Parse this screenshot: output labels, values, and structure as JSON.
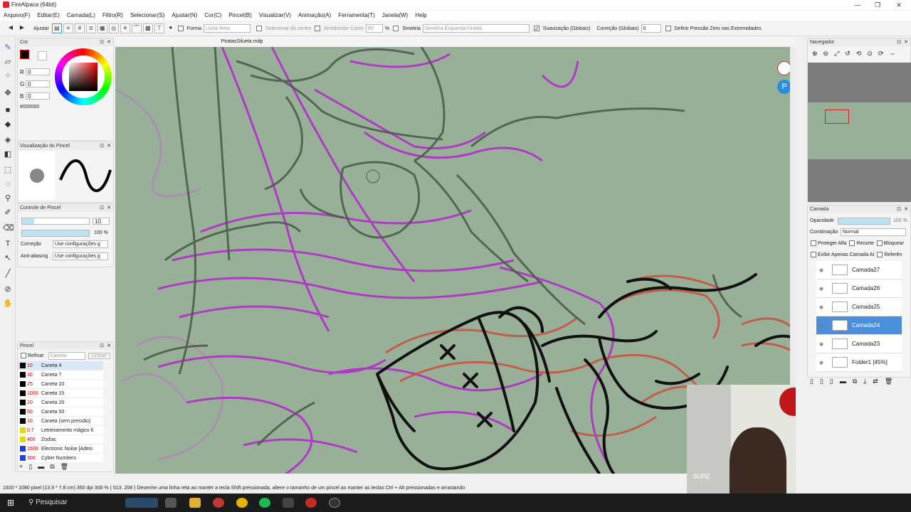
{
  "window": {
    "title": "FireAlpaca (64bit)",
    "min": "—",
    "max": "❐",
    "close": "✕"
  },
  "menu": [
    "Arquivo(F)",
    "Editar(E)",
    "Camada(L)",
    "Filtro(R)",
    "Selecionar(S)",
    "Ajustar(N)",
    "Cor(C)",
    "Pincel(B)",
    "Visualizar(V)",
    "Animação(A)",
    "Ferramenta(T)",
    "Janela(W)",
    "Help"
  ],
  "toolbar": {
    "adjust": "Ajustar",
    "shape_label": "Forma",
    "shape_value": "Linha Reta",
    "select_center": "Selecionar do centro",
    "round_corner": "Arredondar Canto",
    "round_value": "80",
    "percent": "%",
    "symmetry": "Simetria",
    "symmetry_value": "Simetria Esquerda-Direita",
    "smoothing": "Suavização (Globais)",
    "correction": "Correção (Globais)",
    "correction_value": "0",
    "pressure": "Definir Pressão Zero nas Extremidades"
  },
  "doc_tab": "PiratasSilueta.mdp",
  "color_panel": {
    "title": "Cor",
    "r_label": "R",
    "g_label": "G",
    "b_label": "B",
    "r": "0",
    "g": "0",
    "b": "0",
    "hex": "#000000",
    "foreground": "#000000"
  },
  "brush_preview": {
    "title": "Visualização do Pincel"
  },
  "brush_control": {
    "title": "Controle de Pincel",
    "size": "10",
    "opacity": "100 %",
    "correction_label": "Correção",
    "correction_value": "Use configurações g",
    "aa_label": "Anti-aliasing",
    "aa_value": "Use configurações g"
  },
  "brush_panel": {
    "title": "Pincel",
    "refine": "Refinar",
    "filter": "Caneta",
    "clear": "Limpar",
    "items": [
      {
        "size": "10",
        "name": "Caneta 4",
        "color": "#000000"
      },
      {
        "size": "30",
        "name": "Caneta 7",
        "color": "#000000"
      },
      {
        "size": "25",
        "name": "Caneta 10",
        "color": "#000000"
      },
      {
        "size": "1000",
        "name": "Caneta 15",
        "color": "#000000"
      },
      {
        "size": "20",
        "name": "Caneta 20",
        "color": "#000000"
      },
      {
        "size": "50",
        "name": "Caneta 50",
        "color": "#000000"
      },
      {
        "size": "10",
        "name": "Caneta (sem pressão)",
        "color": "#000000"
      },
      {
        "size": "0.7",
        "name": "Letreiramento mágico fi",
        "color": "#e8d800"
      },
      {
        "size": "400",
        "name": "Zodíac",
        "color": "#e8d800"
      },
      {
        "size": "1500",
        "name": "Electronic Noise [Adesi",
        "color": "#2040e0"
      },
      {
        "size": "300",
        "name": "Cyber Numbers",
        "color": "#2040e0"
      }
    ]
  },
  "navigator": {
    "title": "Navegador"
  },
  "layers": {
    "title": "Camada",
    "opacity_label": "Opacidade",
    "opacity_value": "100 %",
    "blend_label": "Combinação",
    "blend_value": "Normal",
    "protect_alpha": "Proteger Alfa",
    "clip": "Recorte",
    "lock": "Bloquear",
    "show_only": "Exibir Apenas Camada At",
    "reference": "Referên",
    "items": [
      {
        "name": "Camada27",
        "selected": false
      },
      {
        "name": "Camada26",
        "selected": false
      },
      {
        "name": "Camada25",
        "selected": false
      },
      {
        "name": "Camada24",
        "selected": true
      },
      {
        "name": "Camada23",
        "selected": false
      },
      {
        "name": "Folder1 [45%]",
        "selected": false
      }
    ]
  },
  "status": "1920 * 1080 pixel  (13.9 * 7.8 cm)  350 dpi  300 %  ( 513, 208 )  Desenhe uma linha reta ao manter a tecla Shift pressionada, altere o tamanho de um pincel ao manter as teclas Ctrl + Alt pressionadas e arrastando",
  "taskbar": {
    "search": "Pesquisar"
  },
  "webcam": {
    "sign": "SUPE"
  }
}
